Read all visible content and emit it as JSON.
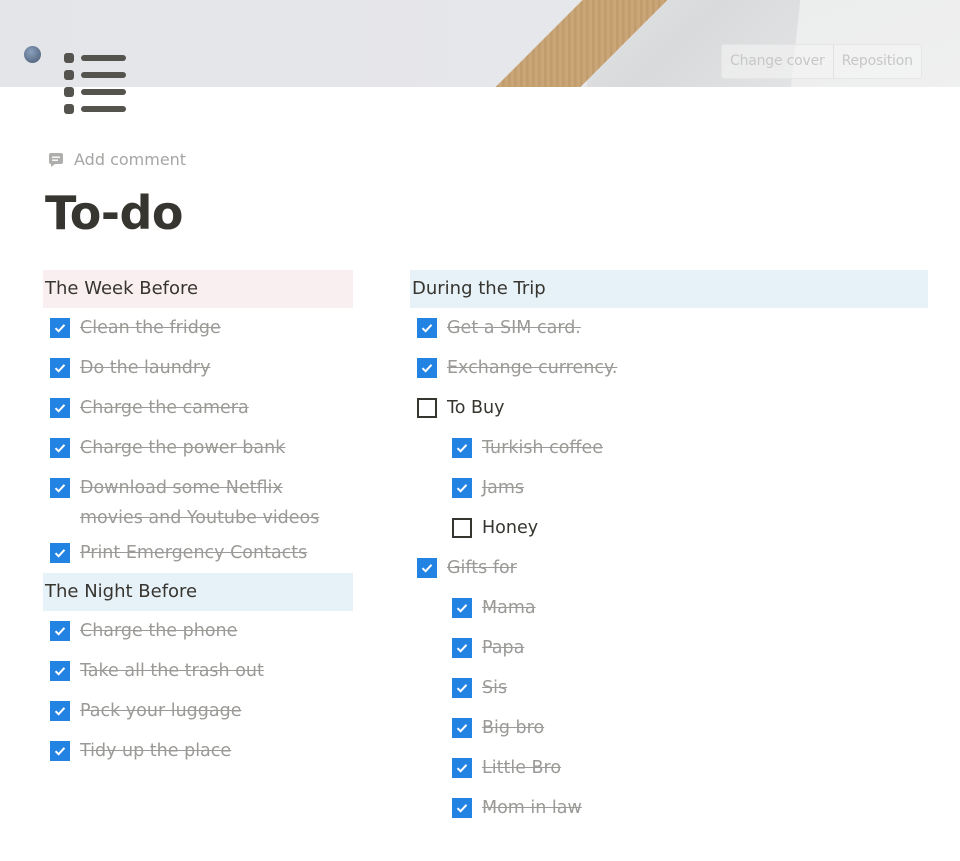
{
  "cover": {
    "change_cover_label": "Change cover",
    "reposition_label": "Reposition"
  },
  "page_icon": "list-bullets-icon",
  "add_comment_label": "Add comment",
  "title": "To-do",
  "colors": {
    "checkbox_checked": "#2383e2",
    "heading_pink_bg": "#f9eff1",
    "heading_blue_bg": "#e7f1f8",
    "done_text": "#9b9a97",
    "text": "#37352f"
  },
  "left": {
    "week_before": {
      "heading": "The Week Before",
      "items": [
        {
          "text": "Clean the fridge",
          "checked": true
        },
        {
          "text": "Do the laundry",
          "checked": true
        },
        {
          "text": "Charge the camera",
          "checked": true
        },
        {
          "text": "Charge the power bank",
          "checked": true
        },
        {
          "text": "Download some Netflix movies and Youtube videos",
          "checked": true
        },
        {
          "text": "Print Emergency Contacts",
          "checked": true
        }
      ]
    },
    "night_before": {
      "heading": "The Night Before",
      "items": [
        {
          "text": "Charge the phone",
          "checked": true
        },
        {
          "text": "Take all the trash out",
          "checked": true
        },
        {
          "text": "Pack your luggage",
          "checked": true
        },
        {
          "text": "Tidy up the place",
          "checked": true
        }
      ]
    }
  },
  "right": {
    "heading": "During the Trip",
    "items": [
      {
        "text": "Get a SIM card.",
        "checked": true
      },
      {
        "text": "Exchange currency.",
        "checked": true
      },
      {
        "text": "To Buy",
        "checked": false
      },
      {
        "text": "Turkish coffee",
        "checked": true
      },
      {
        "text": "Jams",
        "checked": true
      },
      {
        "text": "Honey",
        "checked": false
      },
      {
        "text": "Gifts for",
        "checked": true
      },
      {
        "text": "Mama",
        "checked": true
      },
      {
        "text": "Papa",
        "checked": true
      },
      {
        "text": "Sis",
        "checked": true
      },
      {
        "text": "Big bro",
        "checked": true
      },
      {
        "text": "Little Bro",
        "checked": true
      },
      {
        "text": "Mom in law",
        "checked": true
      }
    ]
  }
}
